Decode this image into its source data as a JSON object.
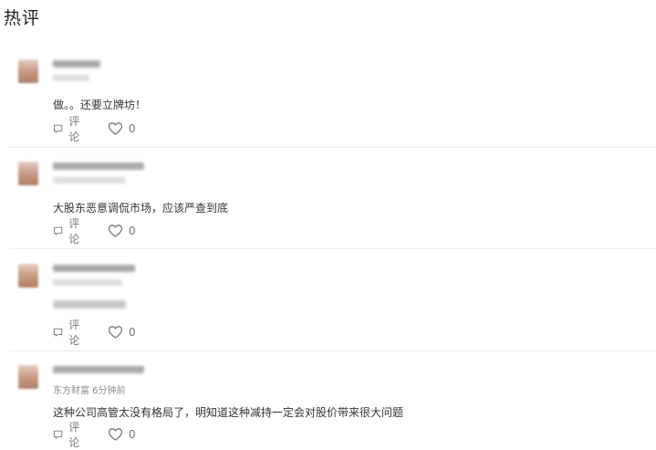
{
  "page_title": "热评",
  "comments": [
    {
      "author": "",
      "meta": "",
      "text": "做。。还要立牌坊！",
      "reply_label": "评论",
      "like_count": "0"
    },
    {
      "author": "",
      "meta": "",
      "text": "大股东恶意调侃市场，应该严查到底",
      "reply_label": "评论",
      "like_count": "0"
    },
    {
      "author": "",
      "meta": "",
      "text": "",
      "reply_label": "评论",
      "like_count": "0"
    },
    {
      "author": "",
      "meta": "东方财富 6分钟前",
      "text": "这种公司高管太没有格局了，明知道这种减持一定会对股价带来很大问题",
      "reply_label": "评论",
      "like_count": "0"
    }
  ]
}
